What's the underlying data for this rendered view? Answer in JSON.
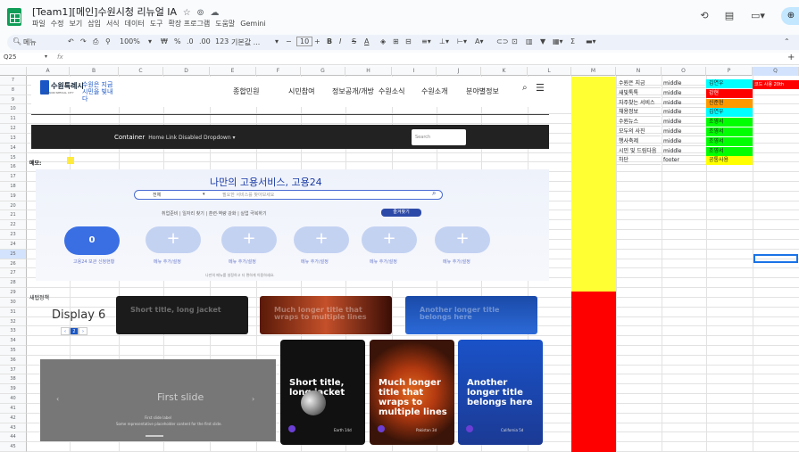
{
  "title": "[Team1][메인]수원시청 리뉴얼 IA",
  "menus": [
    "파일",
    "수정",
    "보기",
    "삽입",
    "서식",
    "데이터",
    "도구",
    "확장 프로그램",
    "도움말",
    "Gemini"
  ],
  "toolbar": {
    "search": "메뉴",
    "zoom": "100%",
    "currency": "₩",
    "percent": "%",
    "dec1": ".0",
    "dec2": ".00",
    "num": "123",
    "font": "기본값 ...",
    "size": "10"
  },
  "namebox": "Q25",
  "fx": "fx",
  "columns": [
    "A",
    "B",
    "C",
    "D",
    "E",
    "F",
    "G",
    "H",
    "I",
    "J",
    "K",
    "L",
    "M",
    "N",
    "O",
    "P",
    "Q"
  ],
  "rows": [
    "7",
    "8",
    "9",
    "10",
    "11",
    "12",
    "13",
    "14",
    "15",
    "16",
    "17",
    "18",
    "19",
    "20",
    "21",
    "22",
    "23",
    "24",
    "25",
    "26",
    "27",
    "28",
    "29",
    "30",
    "31",
    "32",
    "33",
    "34",
    "35",
    "36",
    "37",
    "38",
    "39",
    "40",
    "41",
    "42",
    "43",
    "44",
    "45"
  ],
  "site": {
    "name": "수원특례시",
    "sub": "SUWON SPECIAL CITY",
    "slogan": "수원은 지금 시민을 빛내다",
    "nav": [
      "종합민원",
      "시민참여",
      "정보공개/개방",
      "수원소식",
      "수원소개",
      "분야별정보"
    ],
    "bar_brand": "Container",
    "bar_links": "Home   Link   Disabled   Dropdown ▾",
    "search_ph": "Search"
  },
  "memo": "메모:",
  "goyong": {
    "title": "나만의 고용서비스, 고용24",
    "select": "전체",
    "placeholder": "필요한 서비스를 찾아보세요",
    "tags": "취업준비  |  일자리 찾기  |  훈련·역량 강화  |  실업 극복하기",
    "fav": "즐겨찾기",
    "main_circle": "0",
    "main_label": "고용24 보관 신청현황",
    "menu_label": "메뉴 추가/설정",
    "note": "나만의 메뉴를 설정하고 더 편하게 이용하세요."
  },
  "new_tab": "새탭정책",
  "display": "Display 6",
  "pager": [
    "‹",
    "2",
    "›"
  ],
  "small_cards": [
    "Short title, long jacket",
    "Much longer title that wraps to multiple lines",
    "Another longer title belongs here"
  ],
  "carousel": {
    "title": "First slide",
    "label": "First slide label",
    "text": "Some representative placeholder content for the first slide.",
    "prev": "‹",
    "next": "›"
  },
  "tall_cards": [
    {
      "title": "Short title, long jacket",
      "foot": "Earth  14d"
    },
    {
      "title": "Much longer title that wraps to multiple lines",
      "foot": "Pakistan  3d"
    },
    {
      "title": "Another longer title belongs here",
      "foot": "California  5d"
    }
  ],
  "right_table": [
    {
      "n": "수원은 지금",
      "o": "middle",
      "p": "김연우",
      "pc": "#00ffff"
    },
    {
      "n": "새빛톡톡",
      "o": "middle",
      "p": "강현",
      "pc": "#ff0000"
    },
    {
      "n": "자주찾는 서비스",
      "o": "middle",
      "p": "신준현",
      "pc": "#ff9900"
    },
    {
      "n": "채용정보",
      "o": "middle",
      "p": "김연우",
      "pc": "#00ffff"
    },
    {
      "n": "수원뉴스",
      "o": "middle",
      "p": "조영서",
      "pc": "#00ff00"
    },
    {
      "n": "모두의 사진",
      "o": "middle",
      "p": "조영서",
      "pc": "#00ff00"
    },
    {
      "n": "행사축제",
      "o": "middle",
      "p": "조영서",
      "pc": "#00ff00"
    },
    {
      "n": "시민 및 드림다음",
      "o": "middle",
      "p": "조영서",
      "pc": "#00ff00"
    },
    {
      "n": "하단",
      "o": "footer",
      "p": "공통사용",
      "pc": "#ffff00"
    }
  ],
  "q7": "코드 사용 20th"
}
